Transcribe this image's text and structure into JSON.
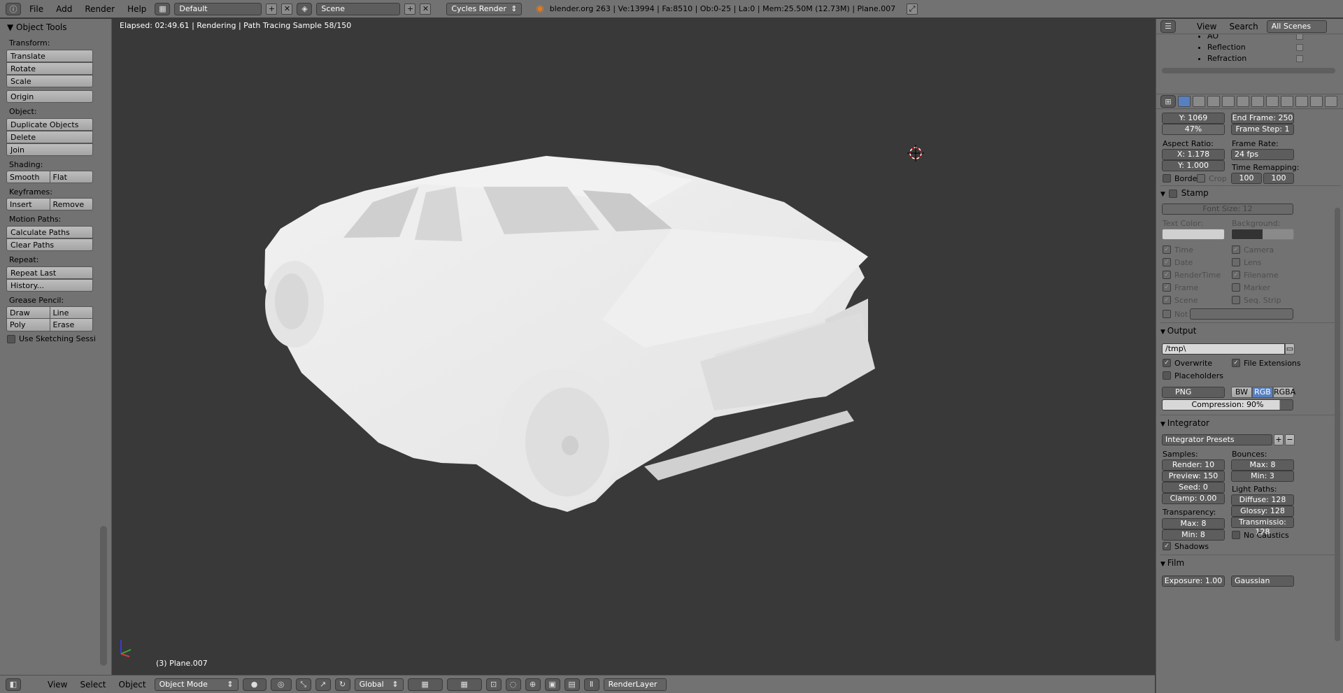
{
  "topbar": {
    "menus": [
      "File",
      "Add",
      "Render",
      "Help"
    ],
    "layout": "Default",
    "scene": "Scene",
    "engine": "Cycles Render",
    "stats": "blender.org 263 | Ve:13994 | Fa:8510 | Ob:0-25 | La:0 | Mem:25.50M (12.73M) | Plane.007"
  },
  "tools": {
    "title": "Object Tools",
    "transform_label": "Transform:",
    "translate": "Translate",
    "rotate": "Rotate",
    "scale": "Scale",
    "origin": "Origin",
    "object_label": "Object:",
    "duplicate": "Duplicate Objects",
    "delete": "Delete",
    "join": "Join",
    "shading_label": "Shading:",
    "smooth": "Smooth",
    "flat": "Flat",
    "keyframes_label": "Keyframes:",
    "insert": "Insert",
    "remove": "Remove",
    "motion_label": "Motion Paths:",
    "calc_paths": "Calculate Paths",
    "clear_paths": "Clear Paths",
    "repeat_label": "Repeat:",
    "repeat_last": "Repeat Last",
    "history": "History...",
    "grease_label": "Grease Pencil:",
    "draw": "Draw",
    "line": "Line",
    "poly": "Poly",
    "erase": "Erase",
    "sketching": "Use Sketching Sessi"
  },
  "viewport": {
    "info": "Elapsed: 02:49.61 | Rendering | Path Tracing Sample 58/150",
    "object": "(3) Plane.007"
  },
  "bottombar": {
    "view": "View",
    "select": "Select",
    "object": "Object",
    "mode": "Object Mode",
    "orientation": "Global",
    "renderlayer": "RenderLayer"
  },
  "outliner": {
    "view": "View",
    "search": "Search",
    "scenes": "All Scenes",
    "items": [
      "AO",
      "Reflection",
      "Refraction"
    ]
  },
  "props": {
    "res_y": "Y: 1069",
    "res_pct": "47%",
    "end_frame": "End Frame: 250",
    "frame_step": "Frame Step: 1",
    "aspect_label": "Aspect Ratio:",
    "aspect_x": "X: 1.178",
    "aspect_y": "Y: 1.000",
    "framerate_label": "Frame Rate:",
    "framerate": "24 fps",
    "remap_label": "Time Remapping:",
    "remap_old": "100",
    "remap_new": "100",
    "border": "Borde",
    "crop": "Crop",
    "stamp": "Stamp",
    "font_size": "Font Size: 12",
    "text_color": "Text Color:",
    "background": "Background:",
    "stamp_left": [
      "Time",
      "Date",
      "RenderTime",
      "Frame",
      "Scene"
    ],
    "stamp_right": [
      "Camera",
      "Lens",
      "Filename",
      "Marker",
      "Seq. Strip"
    ],
    "note": "Not",
    "output": "Output",
    "path": "/tmp\\",
    "overwrite": "Overwrite",
    "file_ext": "File Extensions",
    "placeholders": "Placeholders",
    "format": "PNG",
    "bw": "BW",
    "rgb": "RGB",
    "rgba": "RGBA",
    "compression": "Compression: 90%",
    "integrator": "Integrator",
    "presets": "Integrator Presets",
    "samples_label": "Samples:",
    "render": "Render: 10",
    "preview": "Preview: 150",
    "seed": "Seed: 0",
    "clamp": "Clamp: 0.00",
    "bounces_label": "Bounces:",
    "max": "Max: 8",
    "min": "Min: 3",
    "lightpaths_label": "Light Paths:",
    "diffuse": "Diffuse: 128",
    "glossy": "Glossy: 128",
    "transmission": "Transmissio: 128",
    "transparency_label": "Transparency:",
    "t_max": "Max: 8",
    "t_min": "Min: 8",
    "no_caustics": "No Caustics",
    "shadows": "Shadows",
    "film": "Film",
    "exposure": "Exposure: 1.00",
    "filter": "Gaussian"
  }
}
